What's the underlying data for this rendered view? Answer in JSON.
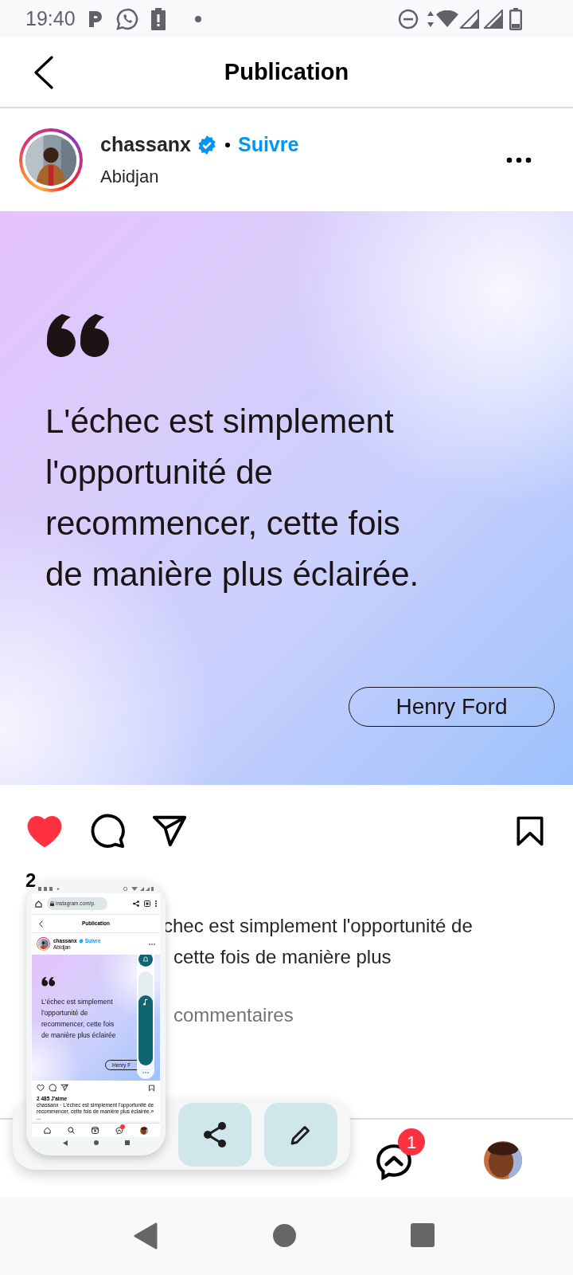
{
  "status_bar": {
    "time": "19:40"
  },
  "header": {
    "title": "Publication"
  },
  "post": {
    "author": {
      "username": "chassanx",
      "verified": true,
      "follow": "Suivre",
      "location": "Abidjan"
    },
    "quote": {
      "lines": [
        "L'échec est simplement",
        "l'opportunité de",
        "recommencer, cette fois",
        "de manière plus éclairée."
      ],
      "author": "Henry Ford"
    },
    "liked": true,
    "likes": "2",
    "caption_lines": [
      "chec est simplement l'opportunité de",
      "cette fois de manière plus"
    ],
    "comments": "commentaires"
  },
  "bottom_nav": {
    "messages_badge": "1"
  },
  "screenshot_preview": {
    "url": "instagram.com/p.",
    "title": "Publication",
    "username": "chassanx",
    "follow": "Suivre",
    "location": "Abidjan",
    "quote_lines": [
      "L'échec est simplement",
      "l'opportunité de",
      "recommencer, cette fois",
      "de manière plus éclairée"
    ],
    "quote_author": "Henry F",
    "liked": false,
    "likes": "2 485 J'aime",
    "caption": "chassanx · L'échec est simplement l'opportunité de recommencer, cette fois de manière plus éclairée.» ...",
    "messages_dot": true,
    "volume": {
      "level": 0.75
    }
  },
  "share_actions": [
    {
      "kind": "share"
    },
    {
      "kind": "edit"
    }
  ]
}
